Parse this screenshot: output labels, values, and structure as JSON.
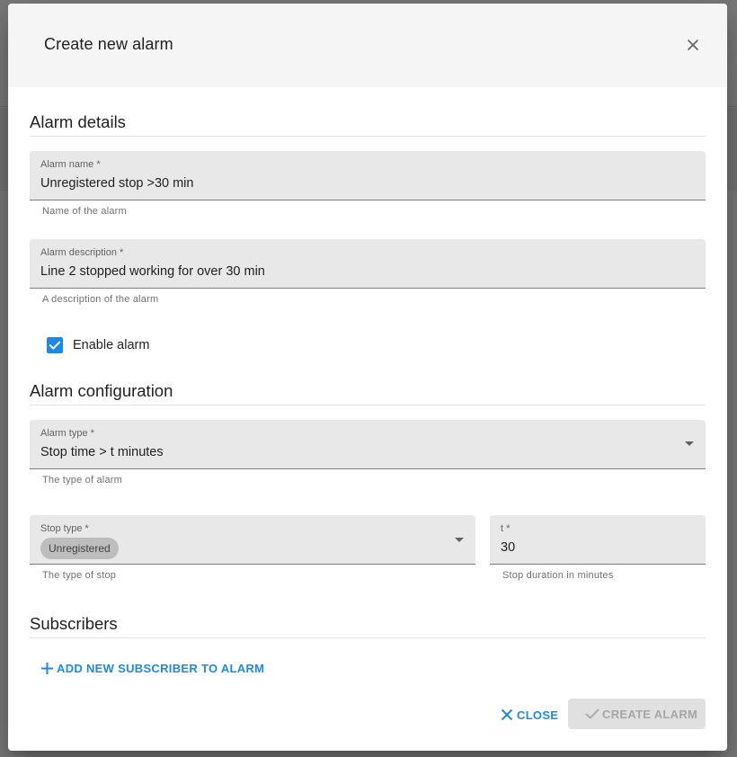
{
  "dialog": {
    "title": "Create new alarm"
  },
  "sections": {
    "details_title": "Alarm details",
    "config_title": "Alarm configuration",
    "subscribers_title": "Subscribers"
  },
  "fields": {
    "alarm_name": {
      "label": "Alarm name *",
      "value": "Unregistered stop >30 min",
      "hint": "Name of the alarm"
    },
    "alarm_description": {
      "label": "Alarm description *",
      "value": "Line 2 stopped working for over 30 min",
      "hint": "A description of the alarm"
    },
    "alarm_type": {
      "label": "Alarm type *",
      "value": "Stop time > t minutes",
      "hint": "The type of alarm"
    },
    "stop_type": {
      "label": "Stop type *",
      "chip": "Unregistered",
      "hint": "The type of stop"
    },
    "t": {
      "label": "t *",
      "value": "30",
      "hint": "Stop duration in minutes"
    }
  },
  "enable_alarm": {
    "label": "Enable alarm",
    "checked": true
  },
  "subscribers": {
    "add_label": "ADD NEW SUBSCRIBER TO ALARM"
  },
  "actions": {
    "close_label": "CLOSE",
    "create_label": "CREATE ALARM"
  },
  "colors": {
    "accent": "#1e88e5",
    "field_bg": "#e8e8e8",
    "header_bg": "#f5f5f5",
    "disabled_bg": "#e0e0e0",
    "disabled_text": "#a6a6a6"
  }
}
